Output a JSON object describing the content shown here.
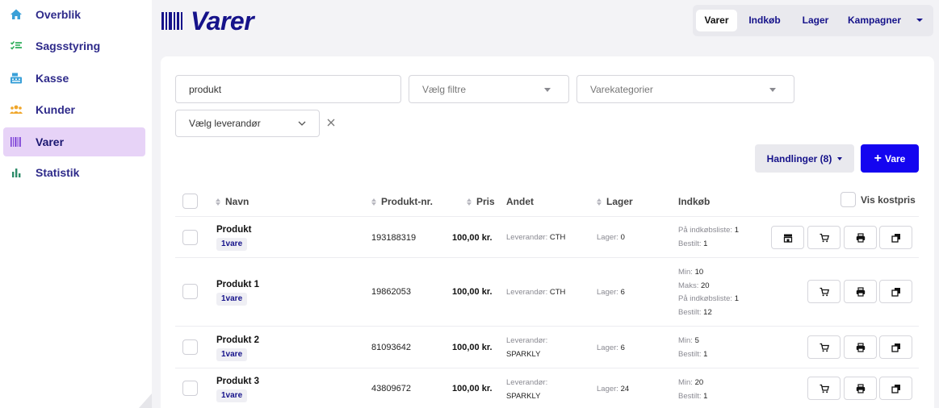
{
  "sidebar": {
    "items": [
      {
        "label": "Overblik",
        "icon": "home-icon",
        "color": "#3aa0d8"
      },
      {
        "label": "Sagsstyring",
        "icon": "checklist-icon",
        "color": "#2fae5c"
      },
      {
        "label": "Kasse",
        "icon": "cash-register-icon",
        "color": "#3aa0d8"
      },
      {
        "label": "Kunder",
        "icon": "users-icon",
        "color": "#f0a62a"
      },
      {
        "label": "Varer",
        "icon": "barcode-icon",
        "color": "#7b3fd6",
        "active": true
      },
      {
        "label": "Statistik",
        "icon": "bar-chart-icon",
        "color": "#2e8c6a"
      }
    ]
  },
  "header": {
    "title": "Varer",
    "tabs": [
      {
        "label": "Varer",
        "active": true
      },
      {
        "label": "Indkøb"
      },
      {
        "label": "Lager"
      },
      {
        "label": "Kampagner"
      }
    ]
  },
  "filters": {
    "search_value": "produkt",
    "filter_placeholder": "Vælg filtre",
    "category_placeholder": "Varekategorier",
    "supplier_placeholder": "Vælg leverandør"
  },
  "actions": {
    "actions_label": "Handlinger (8)",
    "new_label": "Vare"
  },
  "table": {
    "headers": {
      "name": "Navn",
      "product_no": "Produkt-nr.",
      "price": "Pris",
      "other": "Andet",
      "stock": "Lager",
      "purchase": "Indkøb",
      "show_cost": "Vis kostpris"
    },
    "rows": [
      {
        "name": "Produkt",
        "badge": "1vare",
        "product_no": "193188319",
        "price": "100,00 kr.",
        "supplier_label": "Leverandør:",
        "supplier": "CTH",
        "stock_label": "Lager:",
        "stock": "0",
        "purchase": [
          {
            "label": "På indkøbsliste:",
            "value": "1"
          },
          {
            "label": "Bestilt:",
            "value": "1"
          }
        ]
      },
      {
        "name": "Produkt 1",
        "badge": "1vare",
        "product_no": "19862053",
        "price": "100,00 kr.",
        "supplier_label": "Leverandør:",
        "supplier": "CTH",
        "stock_label": "Lager:",
        "stock": "6",
        "purchase": [
          {
            "label": "Min:",
            "value": "10"
          },
          {
            "label": "Maks:",
            "value": "20"
          },
          {
            "label": "På indkøbsliste:",
            "value": "1"
          },
          {
            "label": "Bestilt:",
            "value": "12"
          }
        ]
      },
      {
        "name": "Produkt 2",
        "badge": "1vare",
        "product_no": "81093642",
        "price": "100,00 kr.",
        "supplier_label": "Leverandør:",
        "supplier": "SPARKLY",
        "stock_label": "Lager:",
        "stock": "6",
        "purchase": [
          {
            "label": "Min:",
            "value": "5"
          },
          {
            "label": "Bestilt:",
            "value": "1"
          }
        ]
      },
      {
        "name": "Produkt 3",
        "badge": "1vare",
        "product_no": "43809672",
        "price": "100,00 kr.",
        "supplier_label": "Leverandør:",
        "supplier": "SPARKLY",
        "stock_label": "Lager:",
        "stock": "24",
        "purchase": [
          {
            "label": "Min:",
            "value": "20"
          },
          {
            "label": "Bestilt:",
            "value": "1"
          }
        ]
      }
    ]
  },
  "colors": {
    "brand": "#15128a",
    "primary_button": "#1405f0",
    "active_nav": "#e7d3f7"
  }
}
